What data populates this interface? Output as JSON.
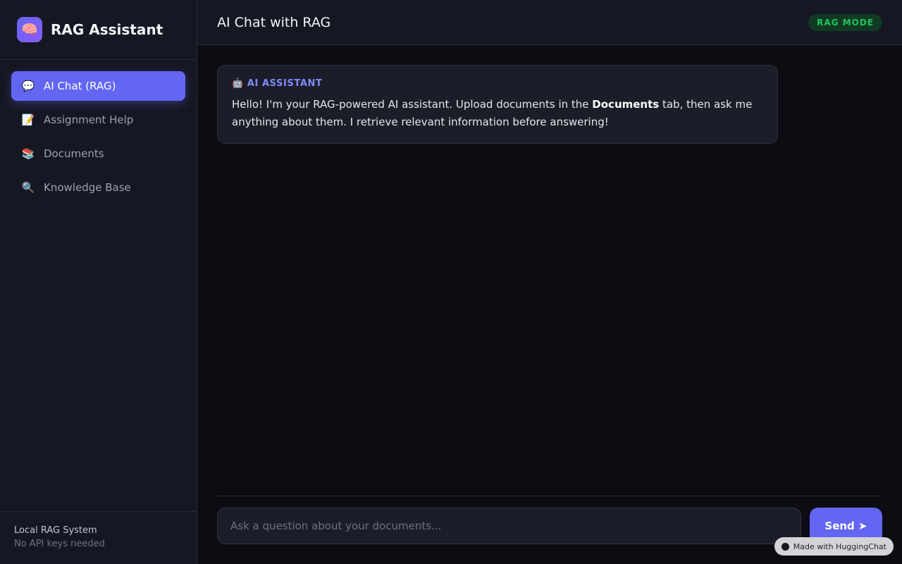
{
  "brand": {
    "icon": "🧠",
    "icon_name": "brain-icon",
    "name": "RAG Assistant"
  },
  "nav": {
    "items": [
      {
        "icon": "💬",
        "icon_name": "speech-bubble-icon",
        "label": "AI Chat (RAG)",
        "active": true
      },
      {
        "icon": "📝",
        "icon_name": "memo-icon",
        "label": "Assignment Help",
        "active": false
      },
      {
        "icon": "📚",
        "icon_name": "books-icon",
        "label": "Documents",
        "active": false
      },
      {
        "icon": "🔍",
        "icon_name": "magnifier-icon",
        "label": "Knowledge Base",
        "active": false
      }
    ]
  },
  "sidebar_footer": {
    "title": "Local RAG System",
    "subtitle": "No API keys needed"
  },
  "header": {
    "title": "AI Chat with RAG",
    "badge": "RAG MODE"
  },
  "messages": [
    {
      "role_icon": "🤖",
      "role_icon_name": "robot-icon",
      "role": "AI ASSISTANT",
      "text_before": "Hello! I'm your RAG-powered AI assistant. Upload documents in the ",
      "text_bold": "Documents",
      "text_after": " tab, then ask me anything about them. I retrieve relevant information before answering!"
    }
  ],
  "composer": {
    "placeholder": "Ask a question about your documents...",
    "send_label": "Send ➤"
  },
  "watermark": {
    "label": "Made with HuggingChat"
  },
  "colors": {
    "accent": "#6366f1",
    "badge_text": "#22c55e",
    "badge_bg": "#113a24",
    "sidebar_bg": "#151722",
    "main_bg": "#0c0c12"
  }
}
